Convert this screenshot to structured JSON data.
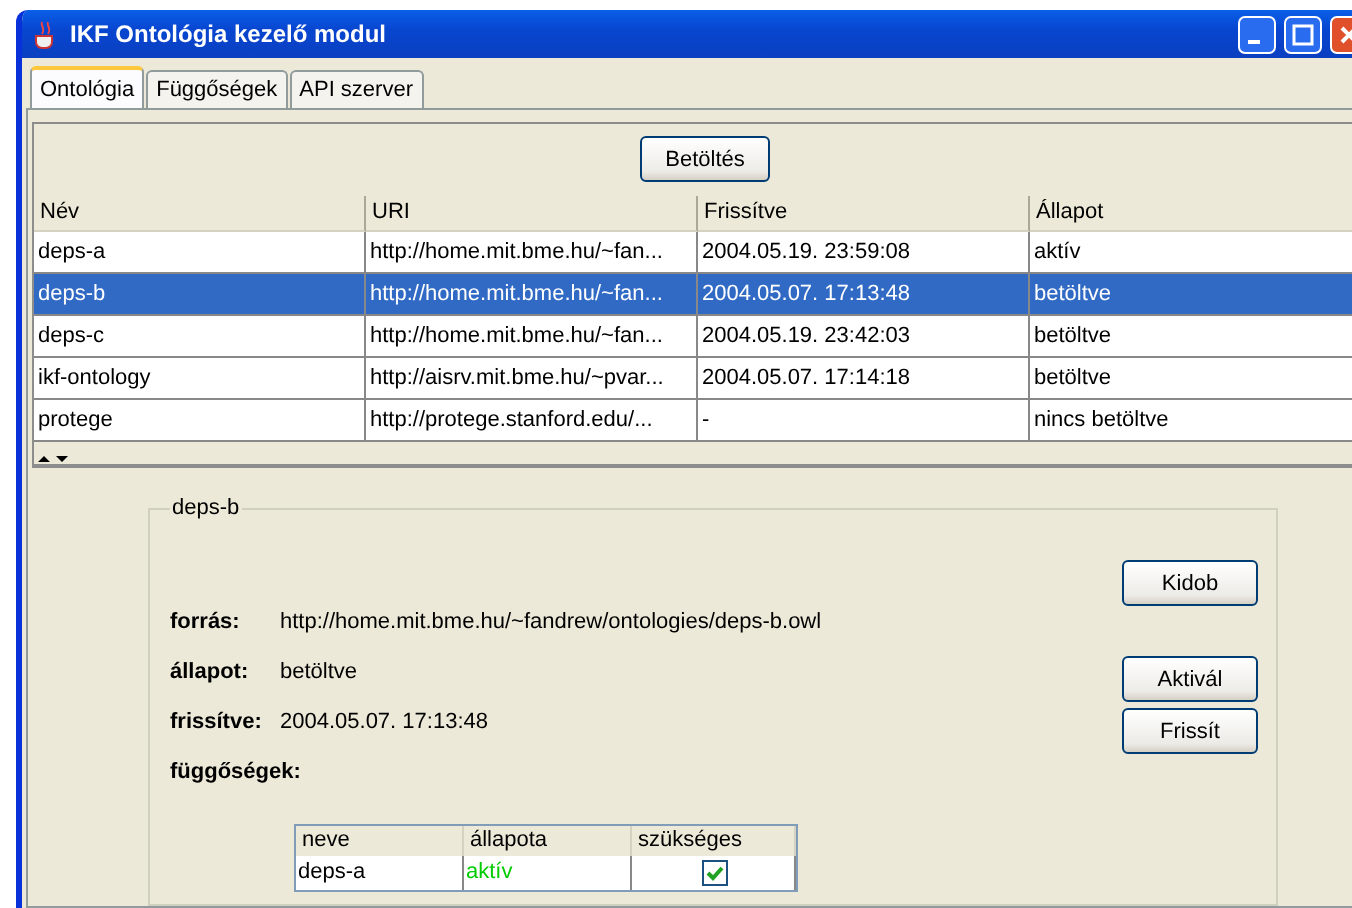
{
  "window": {
    "title": "IKF Ontológia kezelő modul"
  },
  "tabs": [
    {
      "label": "Ontológia",
      "selected": true
    },
    {
      "label": "Függőségek",
      "selected": false
    },
    {
      "label": "API szerver",
      "selected": false
    }
  ],
  "load_button": "Betöltés",
  "table": {
    "columns": [
      "Név",
      "URI",
      "Frissítve",
      "Állapot"
    ],
    "rows": [
      {
        "cells": [
          "deps-a",
          "http://home.mit.bme.hu/~fan...",
          "2004.05.19. 23:59:08",
          "aktív"
        ],
        "selected": false
      },
      {
        "cells": [
          "deps-b",
          "http://home.mit.bme.hu/~fan...",
          "2004.05.07. 17:13:48",
          "betöltve"
        ],
        "selected": true
      },
      {
        "cells": [
          "deps-c",
          "http://home.mit.bme.hu/~fan...",
          "2004.05.19. 23:42:03",
          "betöltve"
        ],
        "selected": false
      },
      {
        "cells": [
          "ikf-ontology",
          "http://aisrv.mit.bme.hu/~pvar...",
          "2004.05.07. 17:14:18",
          "betöltve"
        ],
        "selected": false
      },
      {
        "cells": [
          "protege",
          "http://protege.stanford.edu/...",
          "-",
          "nincs betöltve"
        ],
        "selected": false
      }
    ]
  },
  "details": {
    "title": "deps-b",
    "fields": [
      {
        "label": "forrás:",
        "value": "http://home.mit.bme.hu/~fandrew/ontologies/deps-b.owl"
      },
      {
        "label": "állapot:",
        "value": "betöltve"
      },
      {
        "label": "frissítve:",
        "value": "2004.05.07. 17:13:48"
      }
    ],
    "dependencies_label": "függőségek:",
    "buttons": [
      "Kidob",
      "Aktivál",
      "Frissít"
    ],
    "dependencies": {
      "columns": [
        "neve",
        "állapota",
        "szükséges"
      ],
      "rows": [
        {
          "name": "deps-a",
          "status": "aktív",
          "color": "#00cc00",
          "required": true
        }
      ]
    }
  }
}
